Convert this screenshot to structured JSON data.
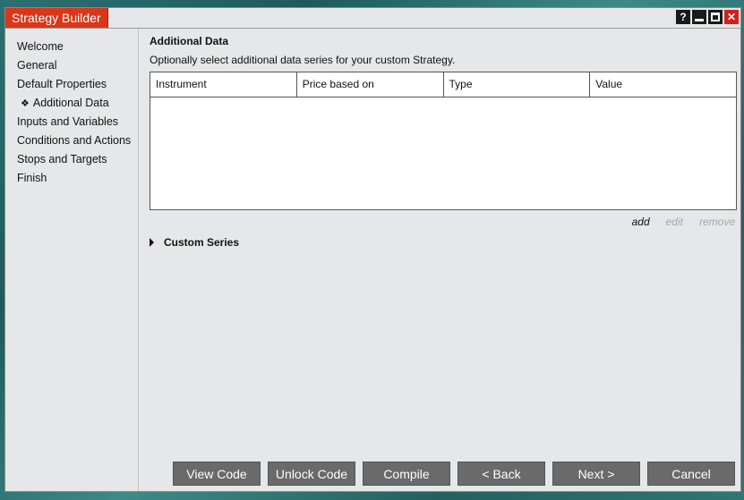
{
  "window": {
    "title": "Strategy Builder",
    "help_label": "?",
    "close_label": "✕"
  },
  "sidebar": {
    "items": [
      {
        "label": "Welcome"
      },
      {
        "label": "General"
      },
      {
        "label": "Default Properties"
      },
      {
        "label": "Additional Data",
        "active": true
      },
      {
        "label": "Inputs and Variables"
      },
      {
        "label": "Conditions and Actions"
      },
      {
        "label": "Stops and Targets"
      },
      {
        "label": "Finish"
      }
    ],
    "active_marker": "❖"
  },
  "main": {
    "title": "Additional Data",
    "description": "Optionally select additional data series for your custom Strategy.",
    "grid": {
      "columns": [
        "Instrument",
        "Price based on",
        "Type",
        "Value"
      ],
      "rows": []
    },
    "actions": {
      "add": "add",
      "edit": "edit",
      "remove": "remove"
    },
    "custom_series_label": "Custom Series"
  },
  "footer": {
    "buttons": [
      "View Code",
      "Unlock Code",
      "Compile",
      "< Back",
      "Next >",
      "Cancel"
    ]
  }
}
